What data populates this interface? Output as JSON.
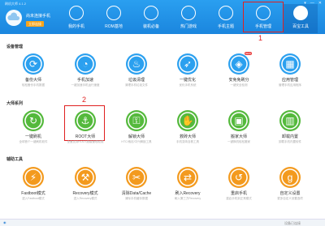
{
  "window": {
    "title": "刷机大师 4.1.2",
    "controls": [
      "▾",
      "—",
      "✕"
    ]
  },
  "header": {
    "status": "尚未连接手机",
    "connect_label": "立即连接"
  },
  "nav": [
    {
      "label": "我的手机",
      "icon": "phone-icon"
    },
    {
      "label": "ROM基地",
      "icon": "rom-icon"
    },
    {
      "label": "装机必备",
      "icon": "bag-icon"
    },
    {
      "label": "热门游戏",
      "icon": "gamepad-icon"
    },
    {
      "label": "手机主题",
      "icon": "shirt-icon"
    },
    {
      "label": "手机管理",
      "icon": "manage-icon"
    },
    {
      "label": "百宝工具",
      "icon": "toolbox-icon"
    }
  ],
  "sections": [
    {
      "title": "设备管理",
      "tools": [
        {
          "name": "备份大师",
          "desc": "轻松备份手机数据",
          "icon": "sync-icon",
          "color": "#2ba0ef"
        },
        {
          "name": "手机加速",
          "desc": "一键加速手机运行速度",
          "icon": "speed-icon",
          "color": "#2ba0ef"
        },
        {
          "name": "垃圾清理",
          "desc": "清理手机垃圾文件",
          "icon": "broom-icon",
          "color": "#2ba0ef"
        },
        {
          "name": "一键优化",
          "desc": "优化手机系统",
          "icon": "rocket-icon",
          "color": "#2ba0ef"
        },
        {
          "name": "安免免刷分",
          "desc": "一键安全检测",
          "icon": "shield-icon",
          "color": "#2ba0ef",
          "badge": "NEW"
        },
        {
          "name": "应用管理",
          "desc": "管理手机应用程序",
          "icon": "grid-icon",
          "color": "#2ba0ef"
        }
      ]
    },
    {
      "title": "大师系列",
      "tools": [
        {
          "name": "一键刷机",
          "desc": "全球首个一键刷机软件",
          "icon": "refresh-icon",
          "color": "#54b93c"
        },
        {
          "name": "ROOT大师",
          "desc": "全面支持ROOT超级管理权限",
          "icon": "anchor-icon",
          "color": "#54b93c"
        },
        {
          "name": "解锁大师",
          "desc": "HTC/索尼/中兴解锁工具",
          "icon": "unlock-icon",
          "color": "#54b93c"
        },
        {
          "name": "救砖大师",
          "desc": "手机变砖自救工具",
          "icon": "hand-icon",
          "color": "#54b93c"
        },
        {
          "name": "搬家大师",
          "desc": "一键换机轻松搬家",
          "icon": "box-icon",
          "color": "#54b93c"
        },
        {
          "name": "卸载内置",
          "desc": "卸载手机内置软件",
          "icon": "trash-icon",
          "color": "#54b93c"
        }
      ]
    },
    {
      "title": "辅助工具",
      "tools": [
        {
          "name": "Fastboot模式",
          "desc": "进入Fastboot模式",
          "icon": "flash-icon",
          "color": "#f39a1e"
        },
        {
          "name": "Recovery模式",
          "desc": "进入Recovery模式",
          "icon": "wrench-icon",
          "color": "#f39a1e"
        },
        {
          "name": "清除Data/Cache",
          "desc": "清除手机缓存数据",
          "icon": "clear-icon",
          "color": "#f39a1e"
        },
        {
          "name": "刷入Recovery",
          "desc": "刷入第三方Recovery",
          "icon": "arrows-icon",
          "color": "#f39a1e"
        },
        {
          "name": "重启手机",
          "desc": "重启手机到正常模式",
          "icon": "restart-icon",
          "color": "#f39a1e"
        },
        {
          "name": "自定义设置",
          "desc": "更多自定义设置选项",
          "icon": "custom-icon",
          "color": "#f39a1e"
        }
      ]
    }
  ],
  "callouts": [
    "1",
    "2"
  ],
  "status": {
    "left": "◉",
    "right": "设备已连接"
  }
}
